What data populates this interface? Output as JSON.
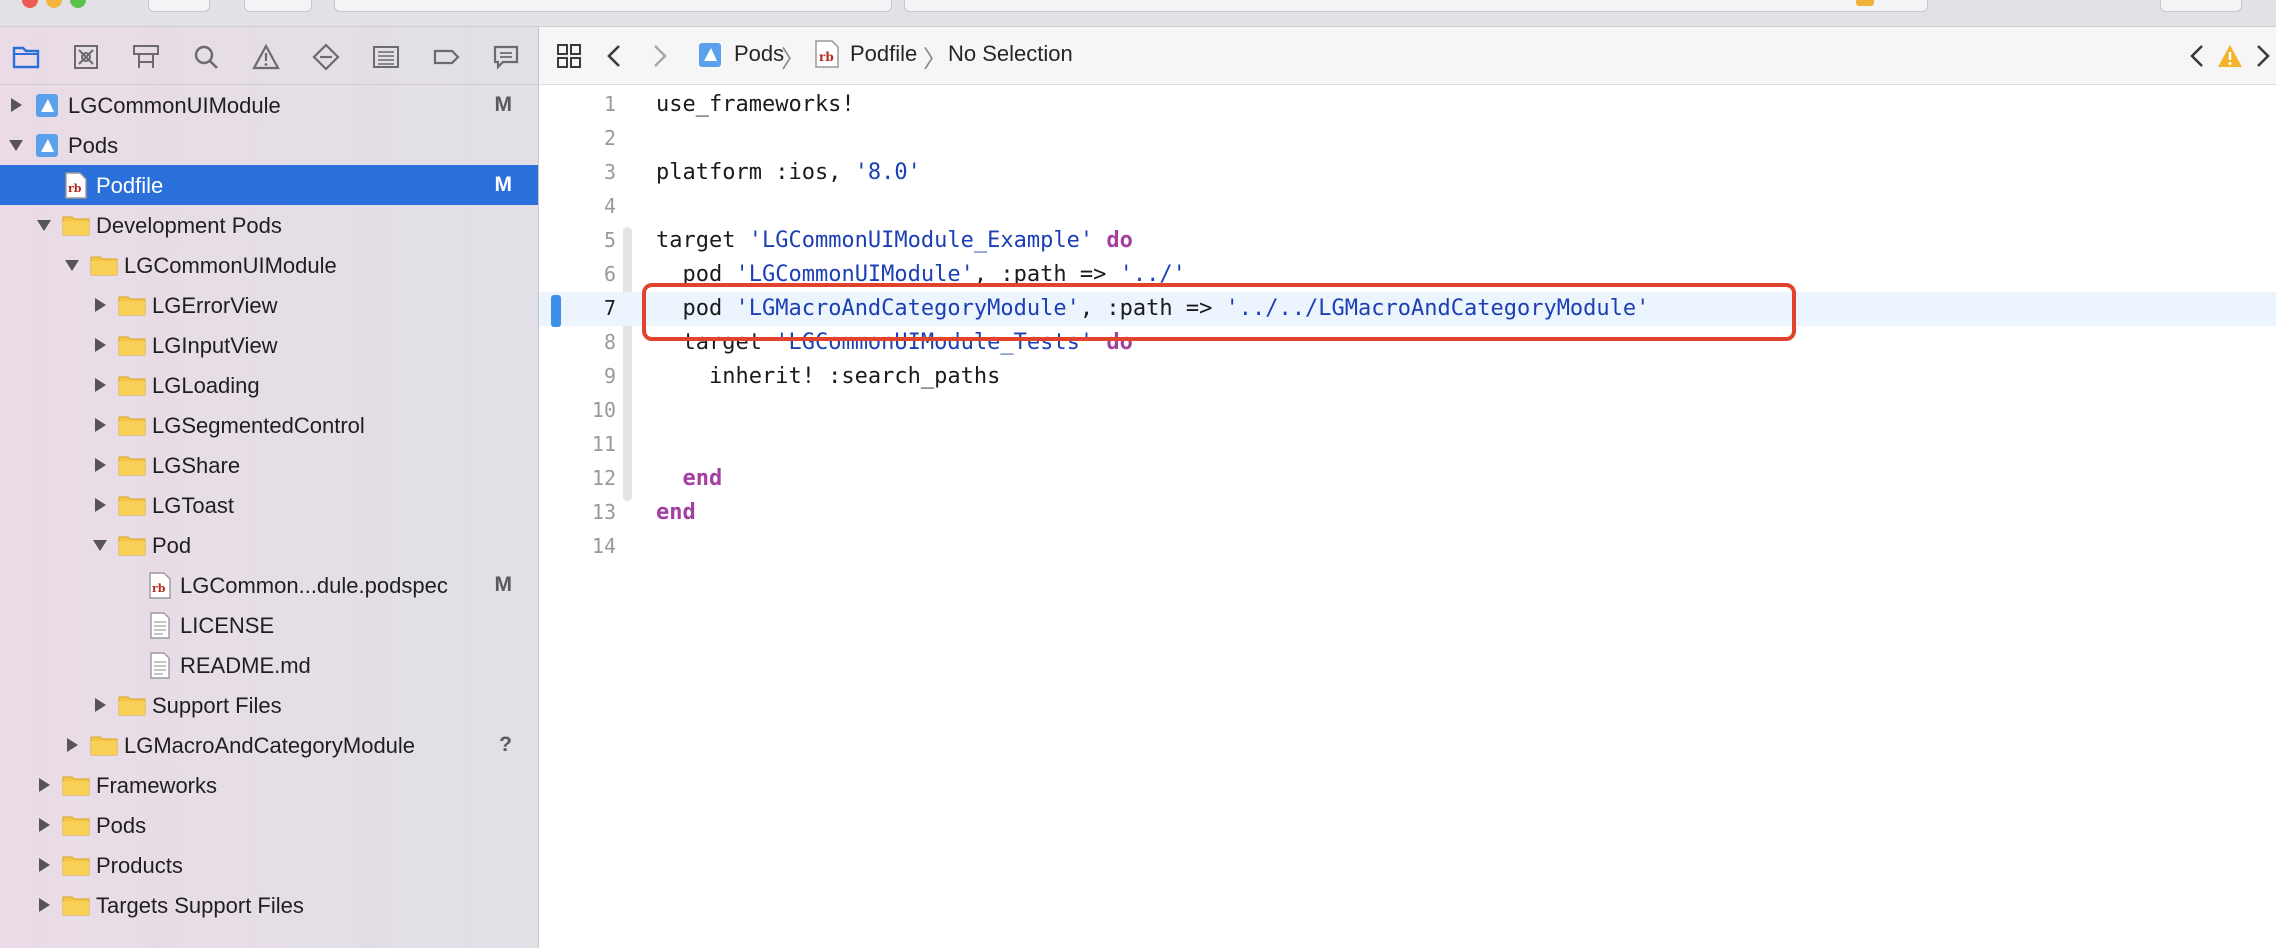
{
  "colors": {
    "selection": "#2a6fda",
    "keyword": "#a23fa0",
    "string": "#1c3fb4",
    "annotation_box": "#e1432c",
    "folder": "#f6c544"
  },
  "navigator": {
    "toolbar_icons": [
      "project-navigator-icon",
      "source-control-icon",
      "symbol-navigator-icon",
      "find-icon",
      "issue-icon",
      "test-icon",
      "debug-icon",
      "breakpoint-icon",
      "report-icon"
    ],
    "tree": [
      {
        "label": "LGCommonUIModule",
        "badge": "M",
        "icon": "xcodeproj-icon",
        "expanded": false,
        "selected": false
      },
      {
        "label": "Pods",
        "badge": "",
        "icon": "xcodeproj-icon",
        "expanded": true,
        "selected": false
      },
      {
        "label": "Podfile",
        "badge": "M",
        "icon": "ruby-file-icon",
        "selected": true
      },
      {
        "label": "Development Pods",
        "badge": "",
        "icon": "folder-icon",
        "expanded": true
      },
      {
        "label": "LGCommonUIModule",
        "badge": "",
        "icon": "folder-icon",
        "expanded": true
      },
      {
        "label": "LGErrorView",
        "badge": "",
        "icon": "folder-icon",
        "expanded": false
      },
      {
        "label": "LGInputView",
        "badge": "",
        "icon": "folder-icon",
        "expanded": false
      },
      {
        "label": "LGLoading",
        "badge": "",
        "icon": "folder-icon",
        "expanded": false
      },
      {
        "label": "LGSegmentedControl",
        "badge": "",
        "icon": "folder-icon",
        "expanded": false
      },
      {
        "label": "LGShare",
        "badge": "",
        "icon": "folder-icon",
        "expanded": false
      },
      {
        "label": "LGToast",
        "badge": "",
        "icon": "folder-icon",
        "expanded": false
      },
      {
        "label": "Pod",
        "badge": "",
        "icon": "folder-icon",
        "expanded": true
      },
      {
        "label": "LGCommon...dule.podspec",
        "badge": "M",
        "icon": "ruby-file-icon"
      },
      {
        "label": "LICENSE",
        "badge": "",
        "icon": "text-file-icon"
      },
      {
        "label": "README.md",
        "badge": "",
        "icon": "text-file-icon"
      },
      {
        "label": "Support Files",
        "badge": "",
        "icon": "folder-icon",
        "expanded": false
      },
      {
        "label": "LGMacroAndCategoryModule",
        "badge": "?",
        "icon": "folder-icon",
        "expanded": false
      },
      {
        "label": "Frameworks",
        "badge": "",
        "icon": "folder-icon",
        "expanded": false
      },
      {
        "label": "Pods",
        "badge": "",
        "icon": "folder-icon",
        "expanded": false
      },
      {
        "label": "Products",
        "badge": "",
        "icon": "folder-icon",
        "expanded": false
      },
      {
        "label": "Targets Support Files",
        "badge": "",
        "icon": "folder-icon",
        "expanded": false
      }
    ]
  },
  "jumpbar": {
    "crumbs": [
      "Pods",
      "Podfile",
      "No Selection"
    ],
    "warning_icon": "warning-icon"
  },
  "editor": {
    "current_line": 7,
    "lines": [
      {
        "n": "1",
        "tokens": [
          {
            "t": "use_frameworks!",
            "c": ""
          }
        ]
      },
      {
        "n": "2",
        "tokens": []
      },
      {
        "n": "3",
        "tokens": [
          {
            "t": "platform :ios, ",
            "c": ""
          },
          {
            "t": "'8.0'",
            "c": "str"
          }
        ]
      },
      {
        "n": "4",
        "tokens": []
      },
      {
        "n": "5",
        "tokens": [
          {
            "t": "target ",
            "c": ""
          },
          {
            "t": "'LGCommonUIModule_Example'",
            "c": "str"
          },
          {
            "t": " ",
            "c": ""
          },
          {
            "t": "do",
            "c": "kw"
          }
        ]
      },
      {
        "n": "6",
        "tokens": [
          {
            "t": "  pod ",
            "c": ""
          },
          {
            "t": "'LGCommonUIModule'",
            "c": "str"
          },
          {
            "t": ", :path => ",
            "c": ""
          },
          {
            "t": "'../'",
            "c": "str"
          }
        ]
      },
      {
        "n": "7",
        "tokens": [
          {
            "t": "  pod ",
            "c": ""
          },
          {
            "t": "'LGMacroAndCategoryModule'",
            "c": "str"
          },
          {
            "t": ", :path => ",
            "c": ""
          },
          {
            "t": "'../../LGMacroAndCategoryModule'",
            "c": "str"
          }
        ]
      },
      {
        "n": "8",
        "tokens": [
          {
            "t": "  target ",
            "c": ""
          },
          {
            "t": "'LGCommonUIModule_Tests'",
            "c": "str"
          },
          {
            "t": " ",
            "c": ""
          },
          {
            "t": "do",
            "c": "kw"
          }
        ]
      },
      {
        "n": "9",
        "tokens": [
          {
            "t": "    inherit! :search_paths",
            "c": ""
          }
        ]
      },
      {
        "n": "10",
        "tokens": []
      },
      {
        "n": "11",
        "tokens": []
      },
      {
        "n": "12",
        "tokens": [
          {
            "t": "  ",
            "c": ""
          },
          {
            "t": "end",
            "c": "kw"
          }
        ]
      },
      {
        "n": "13",
        "tokens": [
          {
            "t": "end",
            "c": "kw"
          }
        ]
      },
      {
        "n": "14",
        "tokens": []
      }
    ]
  }
}
